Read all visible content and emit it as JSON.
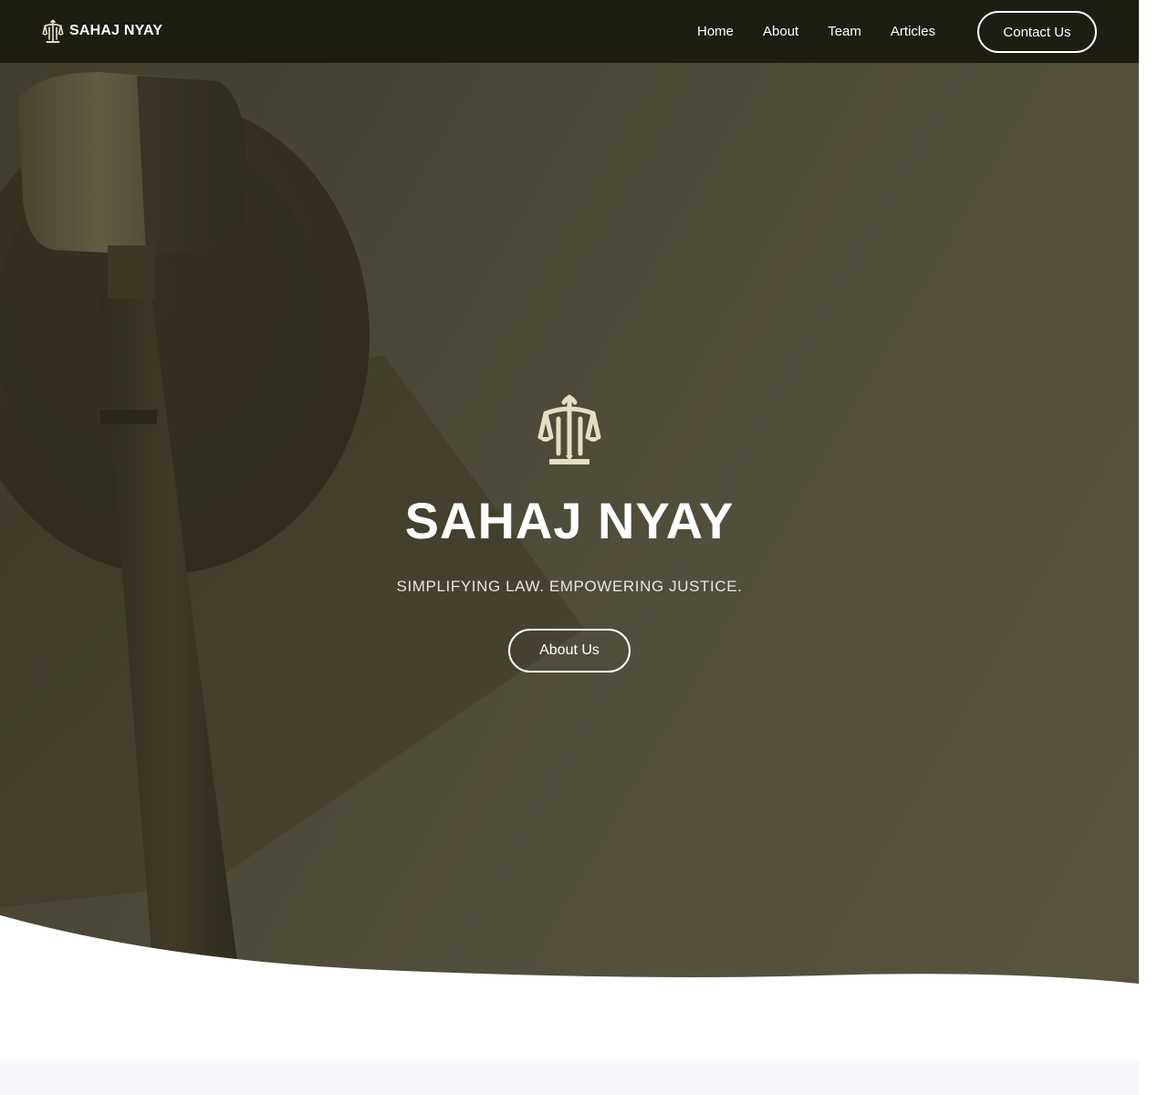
{
  "colors": {
    "navbar_bg": "#1e1d12",
    "hero_tint": "#565240",
    "icon_cream": "#e3e0c2",
    "text_white": "#ffffff",
    "next_section_bg": "#f7f8fc"
  },
  "navbar": {
    "brand": {
      "icon": "scales-of-justice-icon",
      "name": "SAHAJ NYAY"
    },
    "links": [
      {
        "label": "Home"
      },
      {
        "label": "About"
      },
      {
        "label": "Team"
      },
      {
        "label": "Articles"
      }
    ],
    "cta_label": "Contact Us"
  },
  "hero": {
    "background": "gavel-on-sound-block-photo",
    "icon": "scales-of-justice-icon",
    "title": "SAHAJ NYAY",
    "tagline": "SIMPLIFYING LAW. EMPOWERING JUSTICE.",
    "cta_label": "About Us"
  }
}
